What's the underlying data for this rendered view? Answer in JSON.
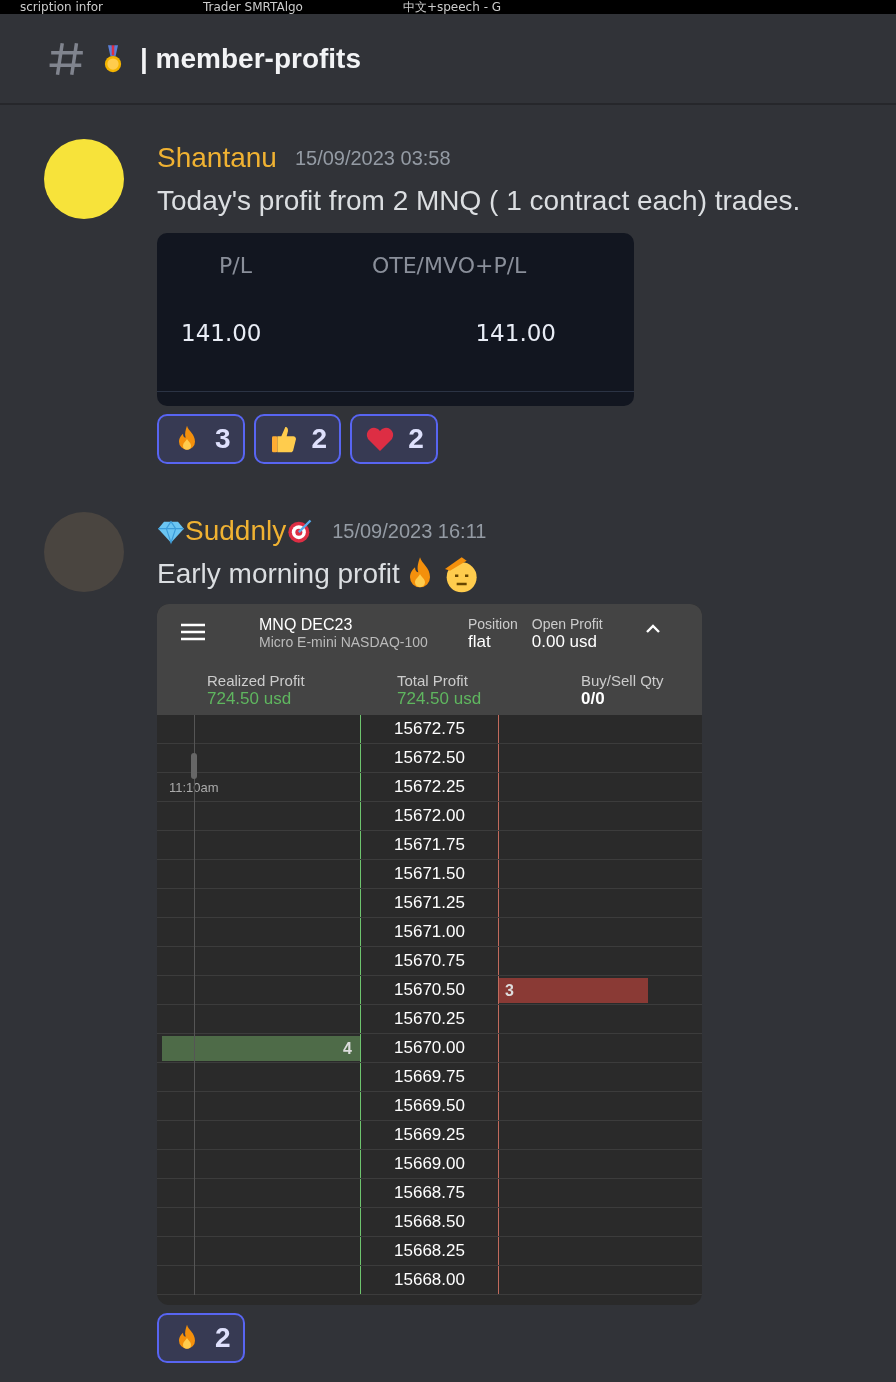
{
  "browser_tabs": [
    {
      "title": "scription infor"
    },
    {
      "title": "Trader SMRTAlgo"
    },
    {
      "title": "中文+speech - G"
    }
  ],
  "channel": {
    "name": "| member-profits"
  },
  "messages": [
    {
      "author": "Shantanu",
      "timestamp": "15/09/2023 03:58",
      "text": "Today's profit from 2 MNQ ( 1 contract each) trades.",
      "attachment": {
        "kind": "pl_table",
        "columns": [
          "P/L",
          "OTE/MVO+P/L"
        ],
        "values": [
          "141.00",
          "141.00"
        ]
      },
      "reactions": [
        {
          "count": "3",
          "selected": true
        },
        {
          "count": "2",
          "selected": true
        },
        {
          "count": "2",
          "selected": true
        }
      ]
    },
    {
      "author": "Suddnly",
      "timestamp": "15/09/2023 16:11",
      "text": "Early morning profit",
      "attachment": {
        "kind": "dom_ladder",
        "symbol": "MNQ DEC23",
        "description": "Micro E-mini NASDAQ-100",
        "position_label": "Position",
        "position": "flat",
        "open_profit_label": "Open Profit",
        "open_profit": "0.00 usd",
        "stats": [
          {
            "label": "Realized Profit",
            "value": "724.50 usd",
            "positive": true
          },
          {
            "label": "Total Profit",
            "value": "724.50 usd",
            "positive": true
          },
          {
            "label": "Buy/Sell Qty",
            "value": "0/0",
            "positive": false
          }
        ],
        "rows": [
          {
            "time": "",
            "price": "15672.75",
            "bid": "",
            "ask": ""
          },
          {
            "time": "",
            "price": "15672.50",
            "bid": "",
            "ask": ""
          },
          {
            "time": "11:10am",
            "price": "15672.25",
            "bid": "",
            "ask": ""
          },
          {
            "time": "",
            "price": "15672.00",
            "bid": "",
            "ask": ""
          },
          {
            "time": "",
            "price": "15671.75",
            "bid": "",
            "ask": ""
          },
          {
            "time": "",
            "price": "15671.50",
            "bid": "",
            "ask": ""
          },
          {
            "time": "",
            "price": "15671.25",
            "bid": "",
            "ask": ""
          },
          {
            "time": "",
            "price": "15671.00",
            "bid": "",
            "ask": ""
          },
          {
            "time": "",
            "price": "15670.75",
            "bid": "",
            "ask": ""
          },
          {
            "time": "",
            "price": "15670.50",
            "bid": "",
            "ask": "3"
          },
          {
            "time": "",
            "price": "15670.25",
            "bid": "",
            "ask": ""
          },
          {
            "time": "",
            "price": "15670.00",
            "bid": "4",
            "ask": ""
          },
          {
            "time": "",
            "price": "15669.75",
            "bid": "",
            "ask": ""
          },
          {
            "time": "",
            "price": "15669.50",
            "bid": "",
            "ask": ""
          },
          {
            "time": "",
            "price": "15669.25",
            "bid": "",
            "ask": ""
          },
          {
            "time": "",
            "price": "15669.00",
            "bid": "",
            "ask": ""
          },
          {
            "time": "",
            "price": "15668.75",
            "bid": "",
            "ask": ""
          },
          {
            "time": "",
            "price": "15668.50",
            "bid": "",
            "ask": ""
          },
          {
            "time": "",
            "price": "15668.25",
            "bid": "",
            "ask": ""
          },
          {
            "time": "",
            "price": "15668.00",
            "bid": "",
            "ask": ""
          }
        ]
      },
      "reactions": [
        {
          "count": "2",
          "selected": true
        }
      ]
    }
  ]
}
